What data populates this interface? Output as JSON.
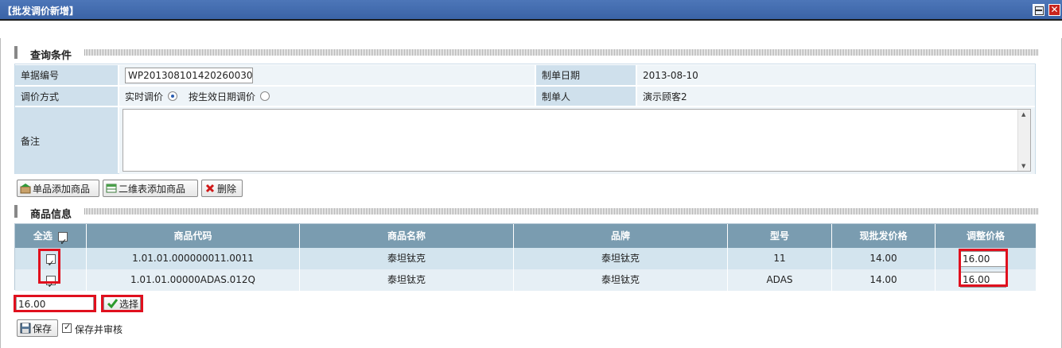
{
  "window": {
    "title": "【批发调价新增】",
    "close_glyph": "✕"
  },
  "query": {
    "section_title": "查询条件",
    "doc_no_label": "单据编号",
    "doc_no_value": "WP201308101420260030",
    "date_label": "制单日期",
    "date_value": "2013-08-10",
    "method_label": "调价方式",
    "method_option_realtime": "实时调价",
    "method_option_effective": "按生效日期调价",
    "creator_label": "制单人",
    "creator_value": "演示顾客2",
    "remark_label": "备注",
    "remark_value": ""
  },
  "toolbar": {
    "add_single": "单品添加商品",
    "add_matrix": "二维表添加商品",
    "delete": "删除"
  },
  "goods": {
    "section_title": "商品信息",
    "select_all": "全选",
    "headers": [
      "商品代码",
      "商品名称",
      "品牌",
      "型号",
      "现批发价格",
      "调整价格"
    ],
    "rows": [
      {
        "checked": true,
        "code": "1.01.01.000000011.0011",
        "name": "泰坦钛克",
        "brand": "泰坦钛克",
        "model": "11",
        "current_price": "14.00",
        "adjusted_price": "16.00"
      },
      {
        "checked": true,
        "code": "1.01.01.00000ADAS.012Q",
        "name": "泰坦钛克",
        "brand": "泰坦钛克",
        "model": "ADAS",
        "current_price": "14.00",
        "adjusted_price": "16.00"
      }
    ]
  },
  "batch": {
    "price_value": "16.00",
    "select_button": "选择"
  },
  "footer": {
    "save_button": "保存",
    "save_audit_label": "保存并审核"
  },
  "colors": {
    "title_bar": "#3a63a6",
    "label_bg": "#cfe0ec",
    "header_bg": "#7a9cb0",
    "highlight": "#e0101e"
  }
}
